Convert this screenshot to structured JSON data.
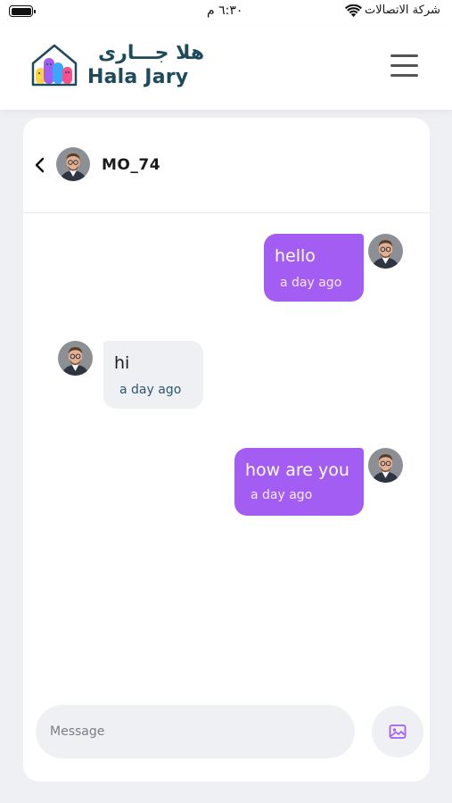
{
  "status_bar": {
    "time": "٦:٣٠ م",
    "carrier": "شركة الاتصالات",
    "wifi_icon": "wifi-icon",
    "battery_icon": "battery-icon"
  },
  "header": {
    "logo_arabic": "هلا جـــارى",
    "logo_text": "Hala Jary",
    "menu_icon": "hamburger-menu-icon"
  },
  "chat": {
    "contact_name": "MO_74",
    "back_icon": "chevron-left-icon",
    "messages": [
      {
        "direction": "outgoing",
        "text": "hello",
        "time": "a day ago"
      },
      {
        "direction": "incoming",
        "text": "hi",
        "time": "a day ago"
      },
      {
        "direction": "outgoing",
        "text": "how are you",
        "time": "a day ago"
      }
    ]
  },
  "composer": {
    "placeholder": "Message",
    "value": "",
    "attach_icon": "image-icon"
  },
  "colors": {
    "accent": "#a45df3",
    "brand_text": "#1d4a5c",
    "background": "#eff0f4",
    "incoming_bubble": "#eef0f4"
  }
}
